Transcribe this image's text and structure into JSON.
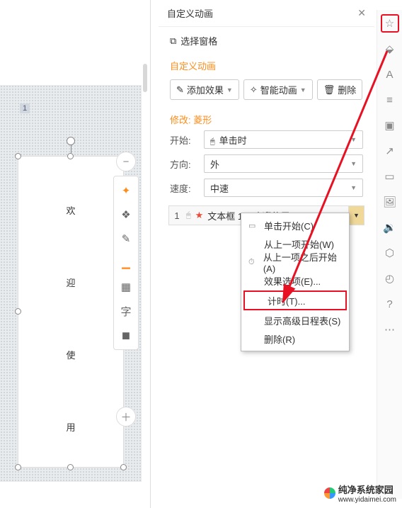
{
  "slide": {
    "number": "1",
    "text_lines": [
      "欢",
      "迎",
      "使",
      "用"
    ]
  },
  "pane": {
    "title": "自定义动画",
    "select_pane": "选择窗格",
    "section_title": "自定义动画",
    "buttons": {
      "add_effect": "添加效果",
      "smart_anim": "智能动画",
      "delete": "删除"
    },
    "modify_title": "修改: 菱形",
    "rows": {
      "start": {
        "label": "开始:",
        "value": "单击时"
      },
      "direction": {
        "label": "方向:",
        "value": "外"
      },
      "speed": {
        "label": "速度:",
        "value": "中速"
      }
    },
    "list_item": {
      "index": "1",
      "label": "文本框 12: 欢迎使用"
    }
  },
  "context_menu": {
    "items": [
      {
        "icon": "▭",
        "label": "单击开始(C)"
      },
      {
        "icon": "",
        "label": "从上一项开始(W)"
      },
      {
        "icon": "⏱",
        "label": "从上一项之后开始(A)"
      },
      {
        "icon": "",
        "label": "效果选项(E)..."
      },
      {
        "icon": "",
        "label": "计时(T)...",
        "hl": true
      },
      {
        "icon": "",
        "label": "显示高级日程表(S)"
      },
      {
        "icon": "",
        "label": "删除(R)"
      }
    ]
  },
  "float_tools": [
    "spark",
    "layers",
    "pen",
    "under",
    "grid",
    "char",
    "shapes"
  ],
  "right_icons": [
    "star",
    "cube",
    "font",
    "sliders",
    "image-stack",
    "share",
    "window",
    "picture",
    "sound",
    "hex",
    "clock",
    "help",
    "dots"
  ],
  "watermark": {
    "brand": "纯净系统家园",
    "url": "www.yidaimei.com"
  }
}
